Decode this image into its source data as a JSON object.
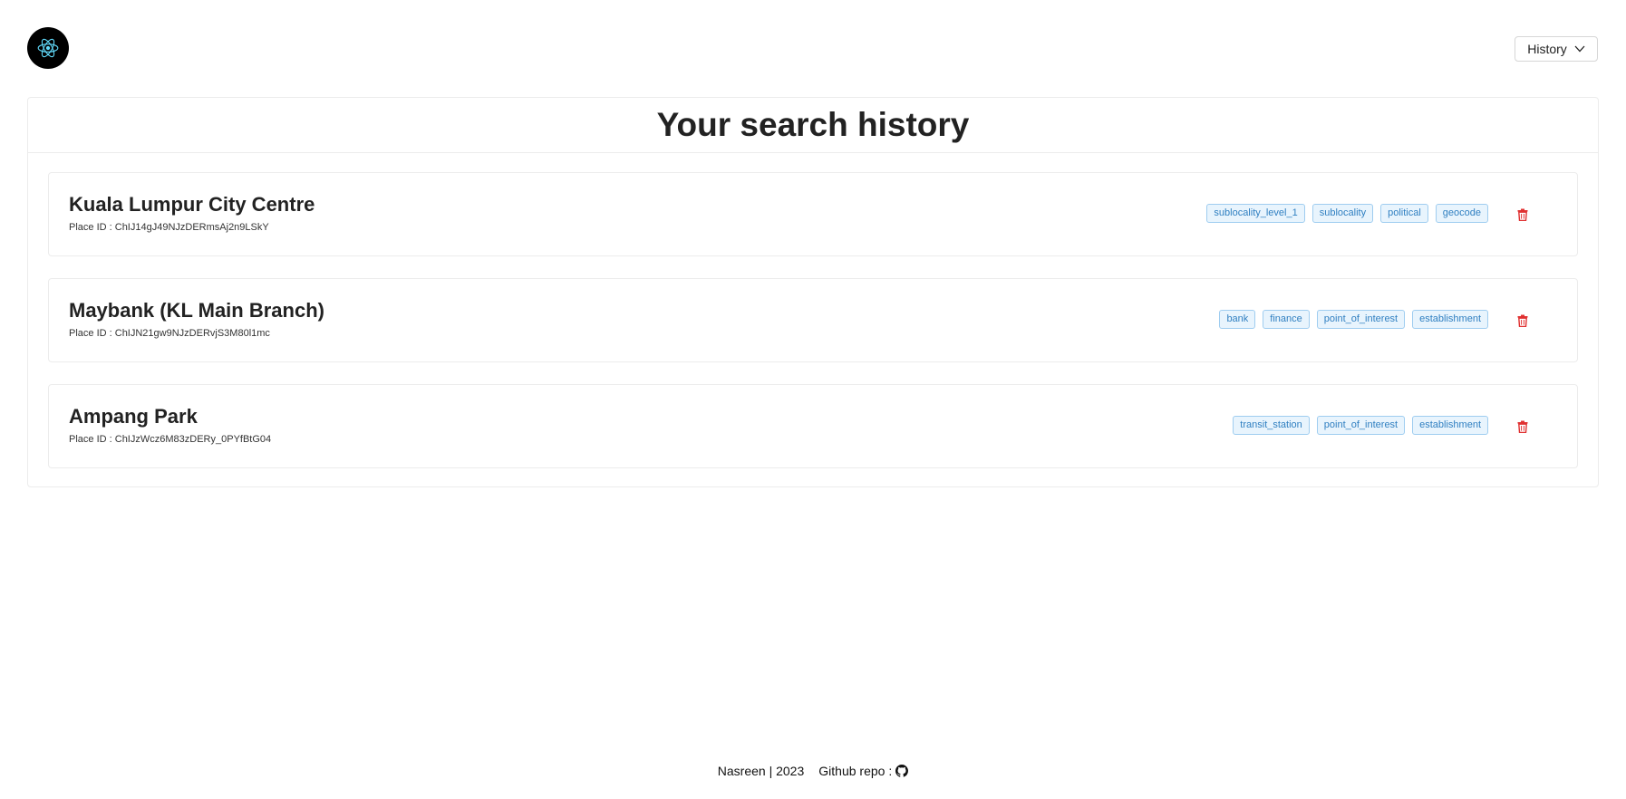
{
  "header": {
    "logo_icon": "react-atom-icon",
    "history_label": "History",
    "history_icon": "chevron-down-icon"
  },
  "main": {
    "title": "Your search history",
    "place_id_prefix": "Place ID : ",
    "items": [
      {
        "name": "Kuala Lumpur City Centre",
        "place_id": "ChIJ14gJ49NJzDERmsAj2n9LSkY",
        "tags": [
          "sublocality_level_1",
          "sublocality",
          "political",
          "geocode"
        ]
      },
      {
        "name": "Maybank (KL Main Branch)",
        "place_id": "ChIJN21gw9NJzDERvjS3M80l1mc",
        "tags": [
          "bank",
          "finance",
          "point_of_interest",
          "establishment"
        ]
      },
      {
        "name": "Ampang Park",
        "place_id": "ChIJzWcz6M83zDERy_0PYfBtG04",
        "tags": [
          "transit_station",
          "point_of_interest",
          "establishment"
        ]
      }
    ]
  },
  "footer": {
    "credit": "Nasreen | 2023",
    "repo_label": "Github repo :",
    "repo_icon": "github-icon"
  },
  "colors": {
    "tag_text": "#2f7fc1",
    "tag_bg": "#e8f4fd",
    "tag_border": "#9fcdf0",
    "delete": "#e03131",
    "react_blue": "#61dafb"
  }
}
